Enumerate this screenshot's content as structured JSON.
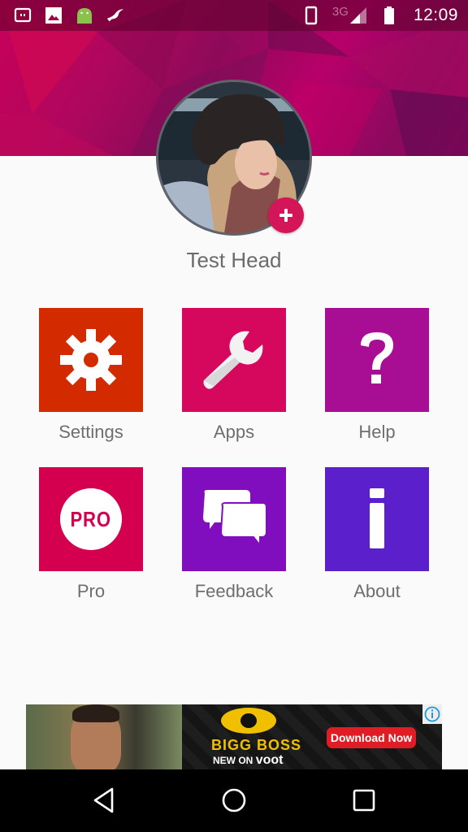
{
  "status_bar": {
    "notification_icons": [
      "screen-mirror-icon",
      "image-icon",
      "android-icon",
      "bird-app-icon"
    ],
    "system_icons": [
      "phone-icon",
      "signal-icon",
      "battery-icon"
    ],
    "network_type": "3G",
    "time": "12:09"
  },
  "profile": {
    "name": "Test Head",
    "add_photo_icon": "plus-icon"
  },
  "menu": {
    "items": [
      {
        "label": "Settings",
        "icon": "gear-icon",
        "color": "#d42a00"
      },
      {
        "label": "Apps",
        "icon": "wrench-icon",
        "color": "#d6085e"
      },
      {
        "label": "Help",
        "icon": "question-icon",
        "color": "#a80e93"
      },
      {
        "label": "Pro",
        "icon": "pro-badge-icon",
        "color": "#d4004f",
        "badge_text": "PRO"
      },
      {
        "label": "Feedback",
        "icon": "chat-bubbles-icon",
        "color": "#800ebf"
      },
      {
        "label": "About",
        "icon": "info-icon",
        "color": "#5c1fcc"
      }
    ]
  },
  "ad": {
    "title": "BIGG BOSS",
    "subtitle_prefix": "NEW ON",
    "subtitle_brand": "voot",
    "cta": "Download Now",
    "info_icon": "info-circle-icon"
  },
  "nav_bar": {
    "back": "back-icon",
    "home": "home-icon",
    "recents": "recents-icon"
  },
  "colors": {
    "accent": "#d41557",
    "banner": "#b0075e",
    "text_secondary": "#6e6e6e"
  }
}
